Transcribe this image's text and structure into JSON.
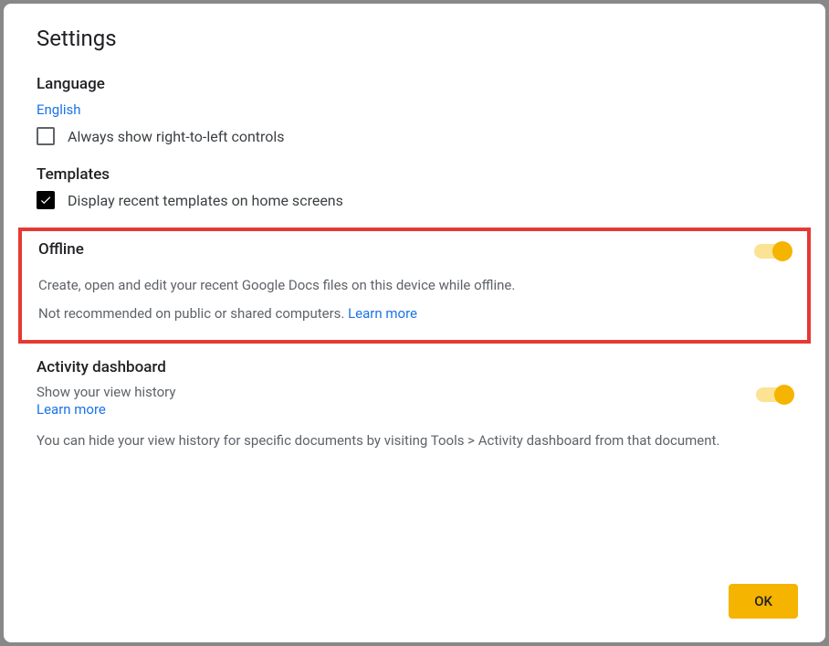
{
  "title": "Settings",
  "language": {
    "heading": "Language",
    "current": "English",
    "rtl_label": "Always show right-to-left controls",
    "rtl_checked": false
  },
  "templates": {
    "heading": "Templates",
    "display_label": "Display recent templates on home screens",
    "display_checked": true
  },
  "offline": {
    "heading": "Offline",
    "description": "Create, open and edit your recent Google Docs files on this device while offline.",
    "warning": "Not recommended on public or shared computers. ",
    "learn_more": "Learn more",
    "enabled": true
  },
  "activity": {
    "heading": "Activity dashboard",
    "show_history": "Show your view history",
    "learn_more": "Learn more",
    "hint": "You can hide your view history for specific documents by visiting Tools > Activity dashboard from that document.",
    "enabled": true
  },
  "footer": {
    "ok": "OK"
  }
}
